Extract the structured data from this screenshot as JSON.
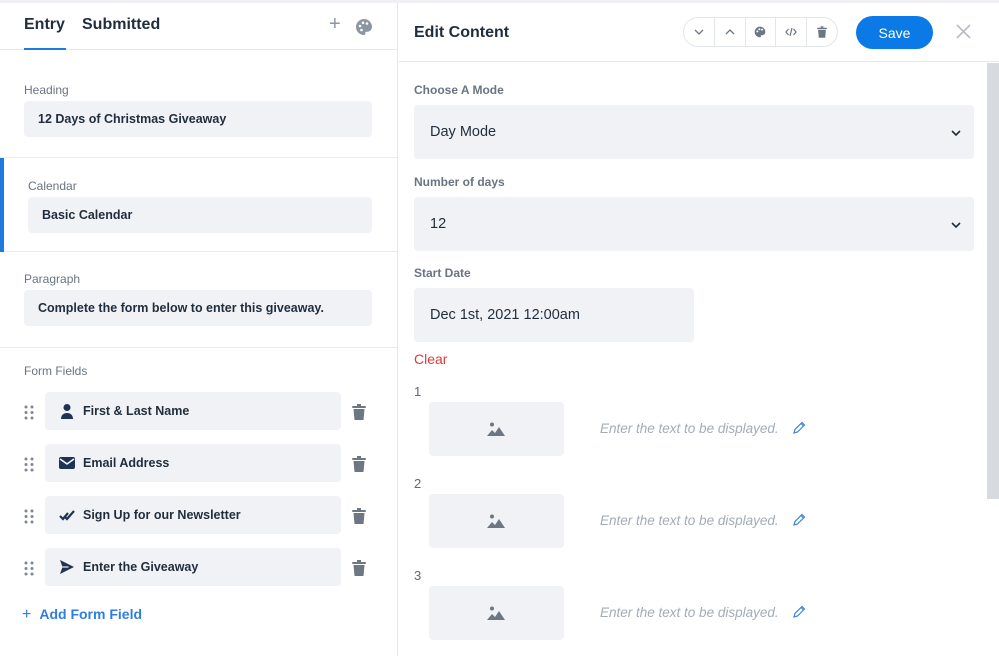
{
  "left": {
    "tabs": {
      "entry": "Entry",
      "submitted": "Submitted",
      "add": "+"
    },
    "sections": {
      "heading": {
        "label": "Heading",
        "value": "12 Days of Christmas Giveaway"
      },
      "calendar": {
        "label": "Calendar",
        "value": "Basic Calendar"
      },
      "paragraph": {
        "label": "Paragraph",
        "value": "Complete the form below to enter this giveaway."
      }
    },
    "form_fields": {
      "label": "Form Fields",
      "items": [
        {
          "label": "First & Last Name",
          "icon": "user-icon"
        },
        {
          "label": "Email Address",
          "icon": "envelope-icon"
        },
        {
          "label": "Sign Up for our Newsletter",
          "icon": "check-icon"
        },
        {
          "label": "Enter the Giveaway",
          "icon": "send-icon"
        }
      ],
      "add_label": "Add Form Field",
      "add_symbol": "+"
    }
  },
  "right": {
    "title": "Edit Content",
    "toolbar": {
      "save_label": "Save"
    },
    "mode": {
      "label": "Choose A Mode",
      "value": "Day Mode"
    },
    "days": {
      "label": "Number of days",
      "value": "12"
    },
    "start_date": {
      "label": "Start Date",
      "value": "Dec 1st, 2021 12:00am",
      "clear_label": "Clear"
    },
    "day_entries": [
      {
        "number": "1",
        "placeholder": "Enter the text to be displayed."
      },
      {
        "number": "2",
        "placeholder": "Enter the text to be displayed."
      },
      {
        "number": "3",
        "placeholder": "Enter the text to be displayed."
      }
    ]
  },
  "colors": {
    "accent": "#0b79e6",
    "danger": "#e03a3a",
    "field_bg": "#f1f2f5",
    "text": "#1f2d3d"
  }
}
